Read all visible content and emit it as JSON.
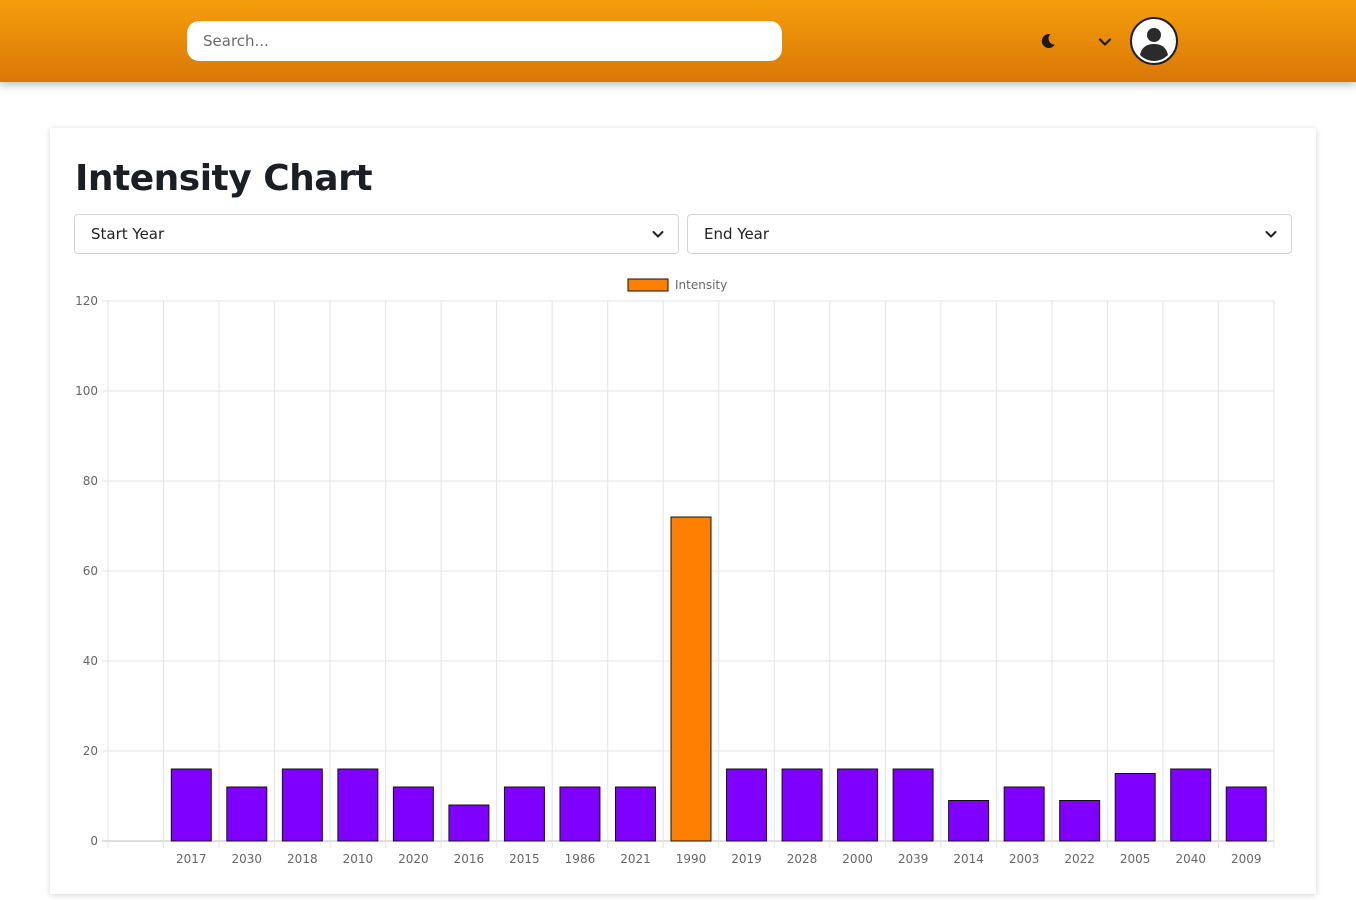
{
  "header": {
    "search_placeholder": "Search...",
    "theme_icon": "moon-icon",
    "menu_icon": "chevron-down-icon",
    "avatar_icon": "user-avatar-icon",
    "gradient_top": "#f59e0b",
    "gradient_bottom": "#d97706"
  },
  "main": {
    "title": "Intensity Chart",
    "start_select_label": "Start Year",
    "end_select_label": "End Year"
  },
  "chart_data": {
    "type": "bar",
    "title": "",
    "xlabel": "",
    "ylabel": "",
    "legend_position": "top-center",
    "grid": true,
    "ylim": [
      0,
      120
    ],
    "yticks": [
      0,
      20,
      40,
      60,
      80,
      100,
      120
    ],
    "categories": [
      "",
      "2017",
      "2030",
      "2018",
      "2010",
      "2020",
      "2016",
      "2015",
      "1986",
      "2021",
      "1990",
      "2019",
      "2028",
      "2000",
      "2039",
      "2014",
      "2003",
      "2022",
      "2005",
      "2040",
      "2009"
    ],
    "series": [
      {
        "name": "Intensity",
        "legend_color": "#ff7f00",
        "values": [
          0,
          16,
          12,
          16,
          16,
          12,
          8,
          12,
          12,
          12,
          72,
          16,
          16,
          16,
          16,
          9,
          12,
          9,
          15,
          16,
          12
        ],
        "colors": [
          "#7f00ff",
          "#7f00ff",
          "#7f00ff",
          "#7f00ff",
          "#7f00ff",
          "#7f00ff",
          "#7f00ff",
          "#7f00ff",
          "#7f00ff",
          "#7f00ff",
          "#ff7f00",
          "#7f00ff",
          "#7f00ff",
          "#7f00ff",
          "#7f00ff",
          "#7f00ff",
          "#7f00ff",
          "#7f00ff",
          "#7f00ff",
          "#7f00ff",
          "#7f00ff"
        ]
      }
    ]
  }
}
